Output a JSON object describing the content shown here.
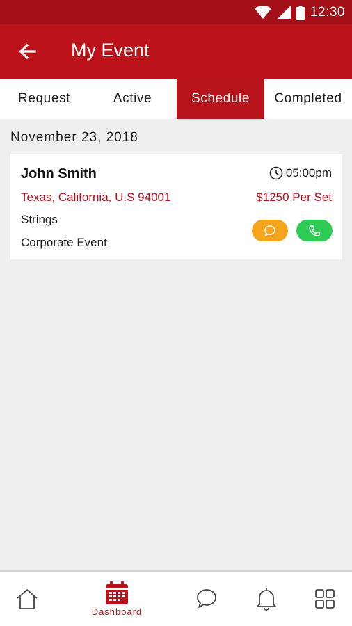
{
  "status_bar": {
    "time": "12:30",
    "icons": [
      "wifi-icon",
      "cell-signal-icon",
      "battery-icon"
    ]
  },
  "app_bar": {
    "title": "My Event",
    "back_icon": "arrow-left-icon"
  },
  "tabs": [
    {
      "label": "Request",
      "active": false
    },
    {
      "label": "Active",
      "active": false
    },
    {
      "label": "Schedule",
      "active": true
    },
    {
      "label": "Completed",
      "active": false
    }
  ],
  "schedule": {
    "date": "November 23, 2018",
    "events": [
      {
        "name": "John Smith",
        "time": "05:00pm",
        "location": "Texas, California, U.S 94001",
        "price": "$1250 Per Set",
        "genre": "Strings",
        "event_type": "Corporate Event"
      }
    ]
  },
  "bottom_nav": {
    "items": [
      {
        "icon": "home-icon",
        "label": "",
        "active": false
      },
      {
        "icon": "calendar-icon",
        "label": "Dashboard",
        "active": true
      },
      {
        "icon": "chat-icon",
        "label": "",
        "active": false
      },
      {
        "icon": "bell-icon",
        "label": "",
        "active": false
      },
      {
        "icon": "grid-icon",
        "label": "",
        "active": false
      }
    ]
  },
  "colors": {
    "status_bar": "#a30f16",
    "primary": "#bb1319",
    "accent_text": "#b5141c",
    "chat_button": "#f4a51c",
    "call_button": "#2ecb55",
    "background": "#efefef"
  }
}
